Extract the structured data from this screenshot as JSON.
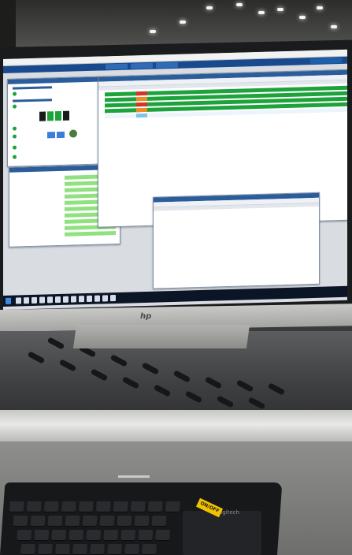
{
  "scene": {
    "description_kind": "photo",
    "brand_mark": "hp",
    "keyboard_brand": "logitech",
    "sticker_text": "ON/OFF"
  },
  "colors": {
    "status_green": "#1ea23c",
    "light_green": "#8fe27f",
    "status_red": "#d9322b",
    "status_orange": "#f08a24",
    "nav_blue": "#184a8d",
    "taskbar": "#0c1525"
  }
}
